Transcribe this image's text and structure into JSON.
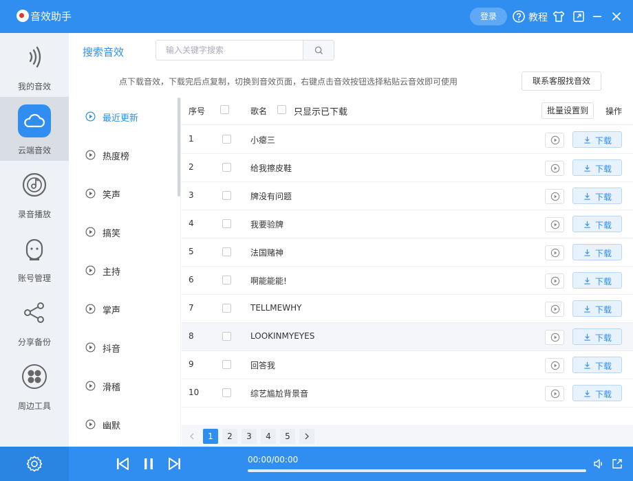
{
  "app": {
    "title": "音效助手",
    "login_label": "登录",
    "tutorial_label": "教程"
  },
  "sidebar": {
    "items": [
      {
        "label": "我的音效",
        "icon": "sound-wave-icon"
      },
      {
        "label": "云端音效",
        "icon": "cloud-icon",
        "active": true
      },
      {
        "label": "录音播放",
        "icon": "record-disc-icon"
      },
      {
        "label": "账号管理",
        "icon": "user-face-icon"
      },
      {
        "label": "分享备份",
        "icon": "share-icon"
      },
      {
        "label": "周边工具",
        "icon": "tools-clover-icon"
      }
    ]
  },
  "search": {
    "title": "搜索音效",
    "placeholder": "输入关键字搜索",
    "hint": "点下载音效，下载完后点复制，切换到音效页面，右键点击音效按钮选择粘贴云音效即可使用",
    "contact_label": "联系客服找音效"
  },
  "categories": [
    {
      "label": "最近更新",
      "active": true
    },
    {
      "label": "热度榜"
    },
    {
      "label": "笑声"
    },
    {
      "label": "搞笑"
    },
    {
      "label": "主持"
    },
    {
      "label": "掌声"
    },
    {
      "label": "抖音"
    },
    {
      "label": "滑稽"
    },
    {
      "label": "幽默"
    }
  ],
  "table": {
    "col_index": "序号",
    "col_name": "歌名",
    "only_downloaded_label": "只显示已下载",
    "batch_label": "批量设置到",
    "col_action": "操作",
    "download_label": "下载",
    "rows": [
      {
        "index": "1",
        "name": "小瘪三"
      },
      {
        "index": "2",
        "name": "给我擦皮鞋"
      },
      {
        "index": "3",
        "name": "牌没有问题"
      },
      {
        "index": "4",
        "name": "我要验牌"
      },
      {
        "index": "5",
        "name": "法国赌神"
      },
      {
        "index": "6",
        "name": "啊能能能!"
      },
      {
        "index": "7",
        "name": "TELLMEWHY"
      },
      {
        "index": "8",
        "name": "LOOKINMYEYES"
      },
      {
        "index": "9",
        "name": "回答我"
      },
      {
        "index": "10",
        "name": "综艺尴尬背景音"
      }
    ]
  },
  "pagination": {
    "pages": [
      "1",
      "2",
      "3",
      "4",
      "5"
    ],
    "current": "1"
  },
  "player": {
    "time": "00:00/00:00",
    "progress": 0
  },
  "colors": {
    "accent": "#2f8ef0",
    "sidebar_bg": "#eef1f6",
    "logo_red": "#e23a2a"
  }
}
